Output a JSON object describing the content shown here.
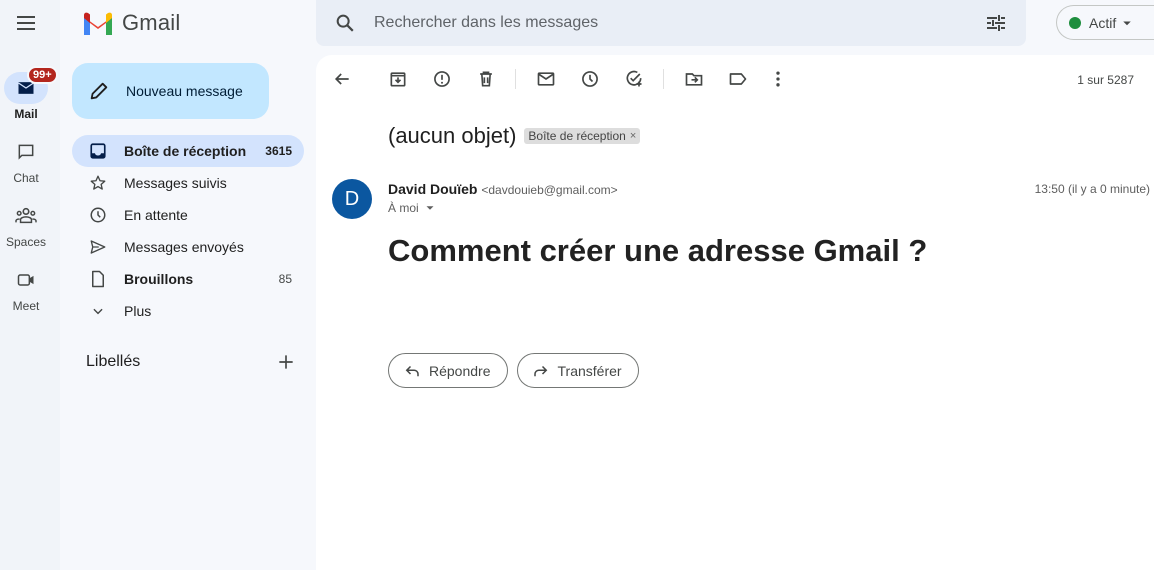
{
  "app": {
    "title": "Gmail"
  },
  "rail": {
    "items": [
      {
        "label": "Mail",
        "badge": "99+",
        "icon": "mail-icon",
        "active": true
      },
      {
        "label": "Chat",
        "icon": "chat-icon"
      },
      {
        "label": "Spaces",
        "icon": "spaces-icon"
      },
      {
        "label": "Meet",
        "icon": "meet-icon"
      }
    ]
  },
  "compose": {
    "label": "Nouveau message"
  },
  "sidebar": {
    "items": [
      {
        "label": "Boîte de réception",
        "count": "3615",
        "icon": "inbox-icon",
        "active": true
      },
      {
        "label": "Messages suivis",
        "count": "",
        "icon": "star-icon"
      },
      {
        "label": "En attente",
        "count": "",
        "icon": "clock-icon"
      },
      {
        "label": "Messages envoyés",
        "count": "",
        "icon": "send-icon"
      },
      {
        "label": "Brouillons",
        "count": "85",
        "icon": "draft-icon"
      },
      {
        "label": "Plus",
        "count": "",
        "icon": "chevron-down-icon"
      }
    ],
    "labels_title": "Libellés"
  },
  "search": {
    "placeholder": "Rechercher dans les messages"
  },
  "status": {
    "label": "Actif",
    "color": "#1e8e3e"
  },
  "toolbar": {
    "pager": "1 sur 5287"
  },
  "message": {
    "subject": "(aucun objet)",
    "label_chip": "Boîte de réception",
    "sender_initial": "D",
    "sender_name": "David Douïeb",
    "sender_email": "<davdouieb@gmail.com>",
    "to": "À moi",
    "time": "13:50 (il y a 0 minute)",
    "body": "Comment créer une adresse Gmail ?",
    "reply_label": "Répondre",
    "forward_label": "Transférer"
  }
}
